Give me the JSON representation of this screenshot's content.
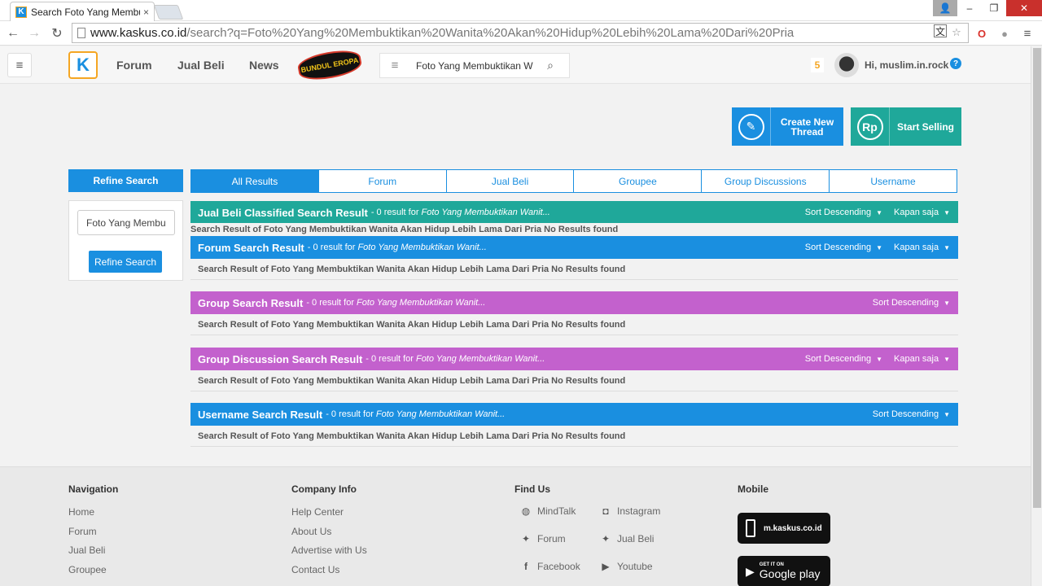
{
  "browser": {
    "tab_title": "Search Foto Yang Membu",
    "tab_close": "×",
    "url_host": "www.kaskus.co.id",
    "url_path": "/search?q=Foto%20Yang%20Membuktikan%20Wanita%20Akan%20Hidup%20Lebih%20Lama%20Dari%20Pria",
    "win_minimize": "–",
    "win_restore": "❐",
    "win_close": "✕"
  },
  "header": {
    "logo": "K",
    "nav": [
      "Forum",
      "Jual Beli",
      "News"
    ],
    "promo_text": "BUNDUL EROPA",
    "search_value": "Foto Yang Membuktikan W",
    "notif_count": "5",
    "greeting": "Hi, muslim.in.rock",
    "help": "?"
  },
  "actions": {
    "create_thread": "Create New Thread",
    "start_selling": "Start Selling",
    "rp": "Rp"
  },
  "refine": {
    "title": "Refine Search",
    "input_value": "Foto Yang Membu",
    "button": "Refine Search"
  },
  "tabs": [
    "All Results",
    "Forum",
    "Jual Beli",
    "Groupee",
    "Group Discussions",
    "Username"
  ],
  "results": {
    "jualbeli": {
      "title": "Jual Beli Classified Search Result",
      "count": "- 0 result for",
      "query": "Foto Yang Membuktikan Wanit...",
      "sort": "Sort Descending",
      "time": "Kapan saja",
      "message": "Search Result of Foto Yang Membuktikan Wanita Akan Hidup Lebih Lama Dari Pria No Results found"
    },
    "forum": {
      "title": "Forum Search Result",
      "count": "- 0 result for",
      "query": "Foto Yang Membuktikan Wanit...",
      "sort": "Sort Descending",
      "time": "Kapan saja",
      "message": "Search Result of Foto Yang Membuktikan Wanita Akan Hidup Lebih Lama Dari Pria No Results found"
    },
    "group": {
      "title": "Group Search Result",
      "count": "- 0 result for",
      "query": "Foto Yang Membuktikan Wanit...",
      "sort": "Sort Descending",
      "message": "Search Result of Foto Yang Membuktikan Wanita Akan Hidup Lebih Lama Dari Pria No Results found"
    },
    "groupdisc": {
      "title": "Group Discussion Search Result",
      "count": "- 0 result for",
      "query": "Foto Yang Membuktikan Wanit...",
      "sort": "Sort Descending",
      "time": "Kapan saja",
      "message": "Search Result of Foto Yang Membuktikan Wanita Akan Hidup Lebih Lama Dari Pria No Results found"
    },
    "username": {
      "title": "Username Search Result",
      "count": "- 0 result for",
      "query": "Foto Yang Membuktikan Wanit...",
      "sort": "Sort Descending",
      "message": "Search Result of Foto Yang Membuktikan Wanita Akan Hidup Lebih Lama Dari Pria No Results found"
    }
  },
  "footer": {
    "navigation": {
      "title": "Navigation",
      "links": [
        "Home",
        "Forum",
        "Jual Beli",
        "Groupee"
      ]
    },
    "company": {
      "title": "Company Info",
      "links": [
        "Help Center",
        "About Us",
        "Advertise with Us",
        "Contact Us"
      ]
    },
    "findus": {
      "title": "Find Us",
      "items": [
        "MindTalk",
        "Instagram",
        "Forum",
        "Jual Beli",
        "Facebook",
        "Youtube"
      ]
    },
    "mobile": {
      "title": "Mobile",
      "site": "m.kaskus.co.id",
      "gp_small": "GET IT ON",
      "gp_big": "Google play"
    }
  },
  "colors": {
    "blue": "#1a8fe0",
    "teal": "#1fa89a",
    "purple": "#c361cd",
    "orange": "#f5a623"
  }
}
